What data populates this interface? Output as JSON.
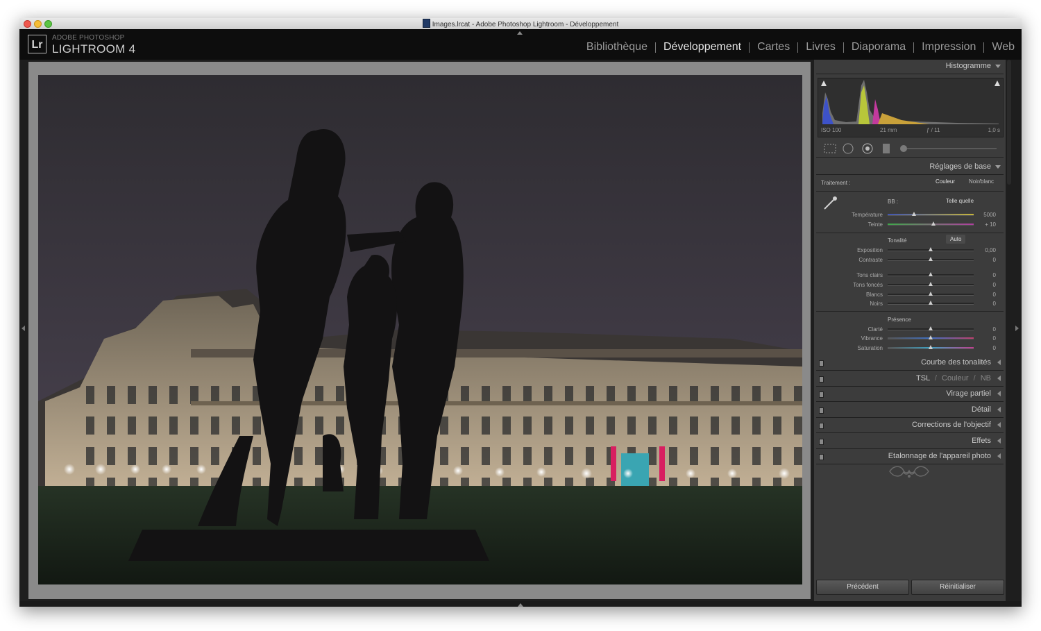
{
  "window": {
    "title": "Images.lrcat - Adobe Photoshop Lightroom - Développement"
  },
  "brand": {
    "logo": "Lr",
    "line1": "ADOBE PHOTOSHOP",
    "line2": "LIGHTROOM 4"
  },
  "modules": [
    {
      "label": "Bibliothèque",
      "active": false
    },
    {
      "label": "Développement",
      "active": true
    },
    {
      "label": "Cartes",
      "active": false
    },
    {
      "label": "Livres",
      "active": false
    },
    {
      "label": "Diaporama",
      "active": false
    },
    {
      "label": "Impression",
      "active": false
    },
    {
      "label": "Web",
      "active": false
    }
  ],
  "histogram": {
    "title": "Histogramme",
    "iso": "ISO 100",
    "focal": "21 mm",
    "aperture": "ƒ / 11",
    "shutter": "1,0 s"
  },
  "basic": {
    "title": "Réglages de base",
    "treatment_label": "Traitement :",
    "treatment_color": "Couleur",
    "treatment_bw": "Noir/blanc",
    "wb_label": "BB :",
    "wb_value": "Telle quelle",
    "temperature": {
      "label": "Température",
      "value": "5000",
      "level": 0.31
    },
    "tint": {
      "label": "Teinte",
      "value": "+ 10",
      "level": 0.53
    },
    "tone_label": "Tonalité",
    "auto_label": "Auto",
    "exposure": {
      "label": "Exposition",
      "value": "0,00",
      "level": 0.5
    },
    "contrast": {
      "label": "Contraste",
      "value": "0",
      "level": 0.5
    },
    "highlights": {
      "label": "Tons clairs",
      "value": "0",
      "level": 0.5
    },
    "shadows": {
      "label": "Tons foncés",
      "value": "0",
      "level": 0.5
    },
    "whites": {
      "label": "Blancs",
      "value": "0",
      "level": 0.5
    },
    "blacks": {
      "label": "Noirs",
      "value": "0",
      "level": 0.5
    },
    "presence_label": "Présence",
    "clarity": {
      "label": "Clarté",
      "value": "0",
      "level": 0.5
    },
    "vibrance": {
      "label": "Vibrance",
      "value": "0",
      "level": 0.5
    },
    "saturation": {
      "label": "Saturation",
      "value": "0",
      "level": 0.5
    }
  },
  "panels": {
    "tone_curve": "Courbe des tonalités",
    "hsl_a": "TSL",
    "hsl_b": "Couleur",
    "hsl_c": "NB",
    "hsl_sep": "/",
    "split_toning": "Virage partiel",
    "detail": "Détail",
    "lens": "Corrections de l'objectif",
    "effects": "Effets",
    "calibration": "Etalonnage de l'appareil photo"
  },
  "buttons": {
    "previous": "Précédent",
    "reset": "Réinitialiser"
  },
  "colors": {
    "background": "#1e1e1e",
    "panel": "#3c3c3c",
    "canvas": "#8a8a8a"
  }
}
